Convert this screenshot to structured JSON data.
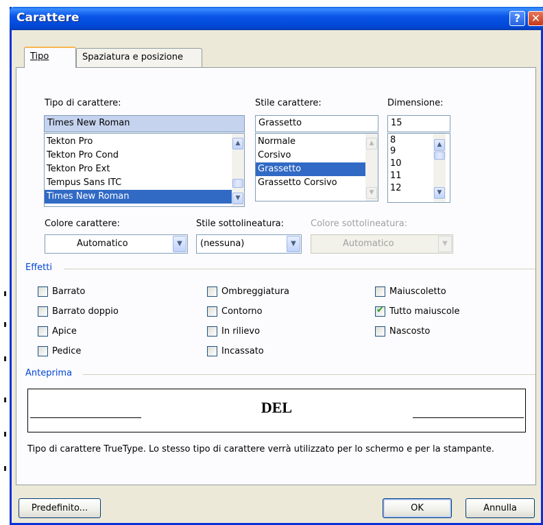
{
  "window": {
    "title": "Carattere",
    "help_glyph": "?",
    "close_glyph": "✕"
  },
  "tabs": [
    {
      "label": "Tipo",
      "active": true
    },
    {
      "label": "Spaziatura e posizione",
      "active": false
    }
  ],
  "font": {
    "label": "Tipo di carattere:",
    "value": "Times New Roman",
    "items": [
      "Tekton Pro",
      "Tekton Pro Cond",
      "Tekton Pro Ext",
      "Tempus Sans ITC",
      "Times New Roman"
    ],
    "selected_index": 4
  },
  "style": {
    "label": "Stile carattere:",
    "value": "Grassetto",
    "items": [
      "Normale",
      "Corsivo",
      "Grassetto",
      "Grassetto Corsivo"
    ],
    "selected_index": 2
  },
  "size": {
    "label": "Dimensione:",
    "value": "15",
    "items": [
      "8",
      "9",
      "10",
      "11",
      "12"
    ]
  },
  "font_color": {
    "label": "Colore carattere:",
    "value": "Automatico"
  },
  "underline_style": {
    "label": "Stile sottolineatura:",
    "value": "(nessuna)"
  },
  "underline_color": {
    "label": "Colore sottolineatura:",
    "value": "Automatico",
    "disabled": true
  },
  "effects": {
    "title": "Effetti",
    "items": [
      {
        "label": "Barrato",
        "checked": false
      },
      {
        "label": "Barrato doppio",
        "checked": false
      },
      {
        "label": "Apice",
        "checked": false
      },
      {
        "label": "Pedice",
        "checked": false
      },
      {
        "label": "Ombreggiatura",
        "checked": false
      },
      {
        "label": "Contorno",
        "checked": false
      },
      {
        "label": "In rilievo",
        "checked": false
      },
      {
        "label": "Incassato",
        "checked": false
      },
      {
        "label": "Maiuscoletto",
        "checked": false
      },
      {
        "label": "Tutto maiuscole",
        "checked": true
      },
      {
        "label": "Nascosto",
        "checked": false
      }
    ]
  },
  "preview": {
    "title": "Anteprima",
    "sample_text": "DEL",
    "description": "Tipo di carattere TrueType. Lo stesso tipo di carattere verrà utilizzato per lo schermo e per la stampante."
  },
  "buttons": {
    "default": "Predefinito...",
    "ok": "OK",
    "cancel": "Annulla"
  },
  "icons": {
    "scroll_up": "▲",
    "scroll_down": "▼",
    "dropdown": "▼",
    "check": "✔"
  },
  "colors": {
    "title_bar": "#0046d5",
    "selection": "#316ac5",
    "accent_tab": "#f9b54c",
    "check": "#21a121"
  }
}
